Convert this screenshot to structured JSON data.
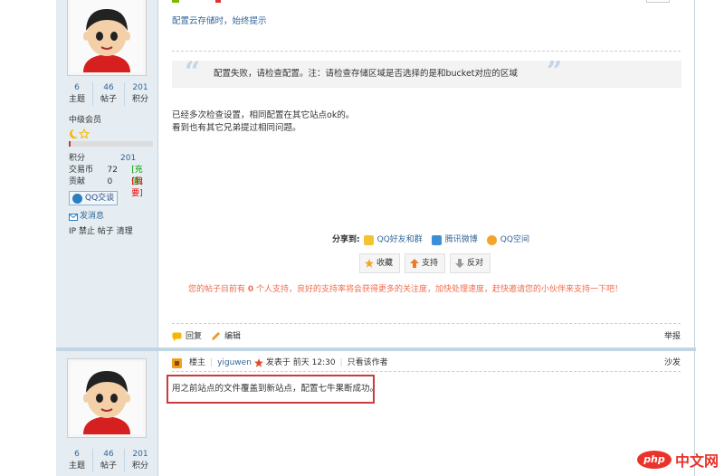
{
  "post1": {
    "subtitle": "配置云存储时，始终提示",
    "quote": "配置失败，请检查配置。注：请检查存储区域是否选择的是和bucket对应的区域",
    "body_lines": [
      "已经多次检查设置，相同配置在其它站点ok的。",
      "看到也有其它兄弟提过相同问题。"
    ],
    "share_label": "分享到:",
    "share_items": [
      "QQ好友和群",
      "腾讯微博",
      "QQ空间"
    ],
    "actions": [
      "收藏",
      "支持",
      "反对"
    ],
    "tip_prefix": "您的帖子目前有",
    "tip_count": "0",
    "tip_suffix": "个人支持，良好的支持率将会获得更多的关注度，加快处理速度，赶快邀请您的小伙伴来支持一下吧！",
    "footer": {
      "reply": "回复",
      "edit": "编辑",
      "report": "举报"
    }
  },
  "user1": {
    "stats": [
      {
        "num": "6",
        "label": "主题"
      },
      {
        "num": "46",
        "label": "帖子"
      },
      {
        "num": "201",
        "label": "积分"
      }
    ],
    "group": "中级会员",
    "level_progress": 0.02,
    "points_label": "积分",
    "points": "201",
    "coins_label": "交易币",
    "coins": "72",
    "coins_link": "[充值]",
    "contrib_label": "贡献",
    "contrib": "0",
    "contrib_link": "[我要]",
    "qq_button": "QQ交谈",
    "message": "发消息",
    "admin": "IP 禁止 帖子 清理"
  },
  "post2": {
    "floor": "楼主",
    "author": "yiguwen",
    "posted": "发表于 前天 12:30",
    "only_author": "只看该作者",
    "position": "沙发",
    "body": "用之前站点的文件覆盖到新站点，配置七牛果断成功。"
  },
  "user2": {
    "stats": [
      {
        "num": "6",
        "label": "主题"
      },
      {
        "num": "46",
        "label": "帖子"
      },
      {
        "num": "201",
        "label": "积分"
      }
    ]
  },
  "watermark": {
    "logo": "php",
    "text": "中文网"
  },
  "colors": {
    "link": "#336699",
    "sidebar": "#e5edf2",
    "tip": "#f26c4f",
    "highlight_box": "#c83c3c"
  }
}
